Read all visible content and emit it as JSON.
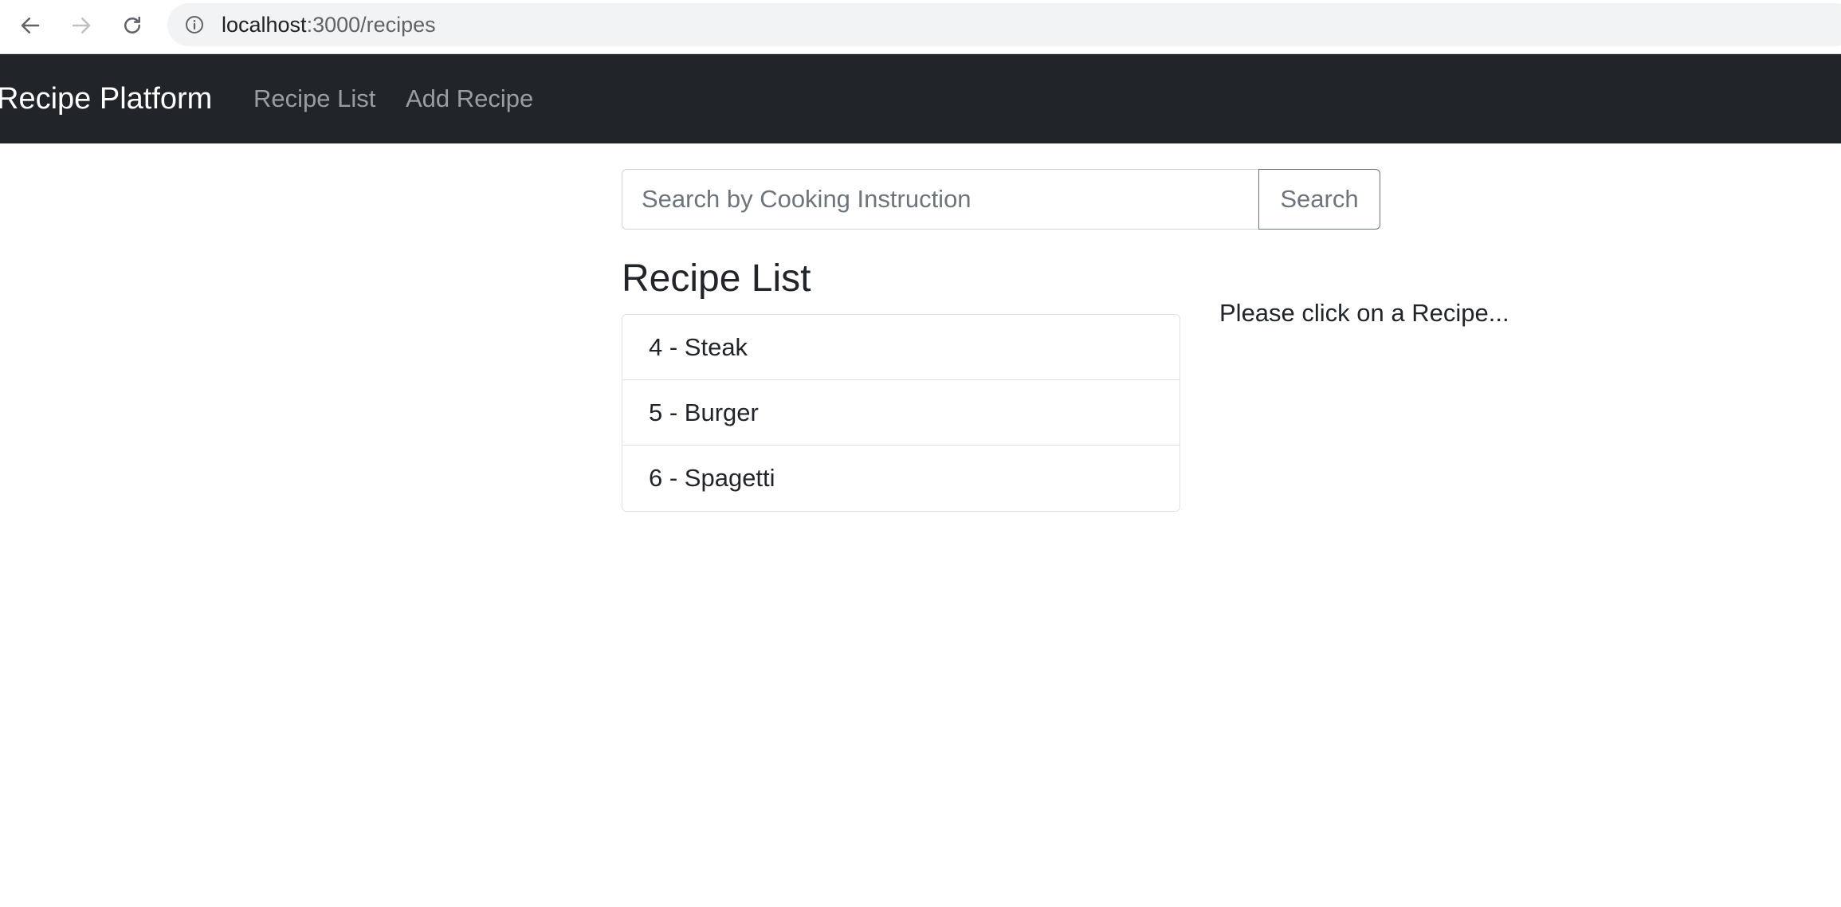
{
  "browser": {
    "url_host": "localhost",
    "url_path": ":3000/recipes",
    "icons": [
      "back-arrow-icon",
      "forward-arrow-icon",
      "reload-icon",
      "info-icon"
    ]
  },
  "navbar": {
    "brand": "Recipe Platform",
    "links": [
      {
        "label": "Recipe List"
      },
      {
        "label": "Add Recipe"
      }
    ],
    "colors": {
      "background": "#212529",
      "link": "#8c8f92"
    }
  },
  "search": {
    "placeholder": "Search by Cooking Instruction",
    "value": "",
    "button_label": "Search"
  },
  "recipe_list": {
    "title": "Recipe List",
    "items": [
      {
        "label": "4 - Steak"
      },
      {
        "label": "5 - Burger"
      },
      {
        "label": "6 - Spagetti"
      }
    ]
  },
  "detail": {
    "hint": "Please click on a Recipe..."
  }
}
